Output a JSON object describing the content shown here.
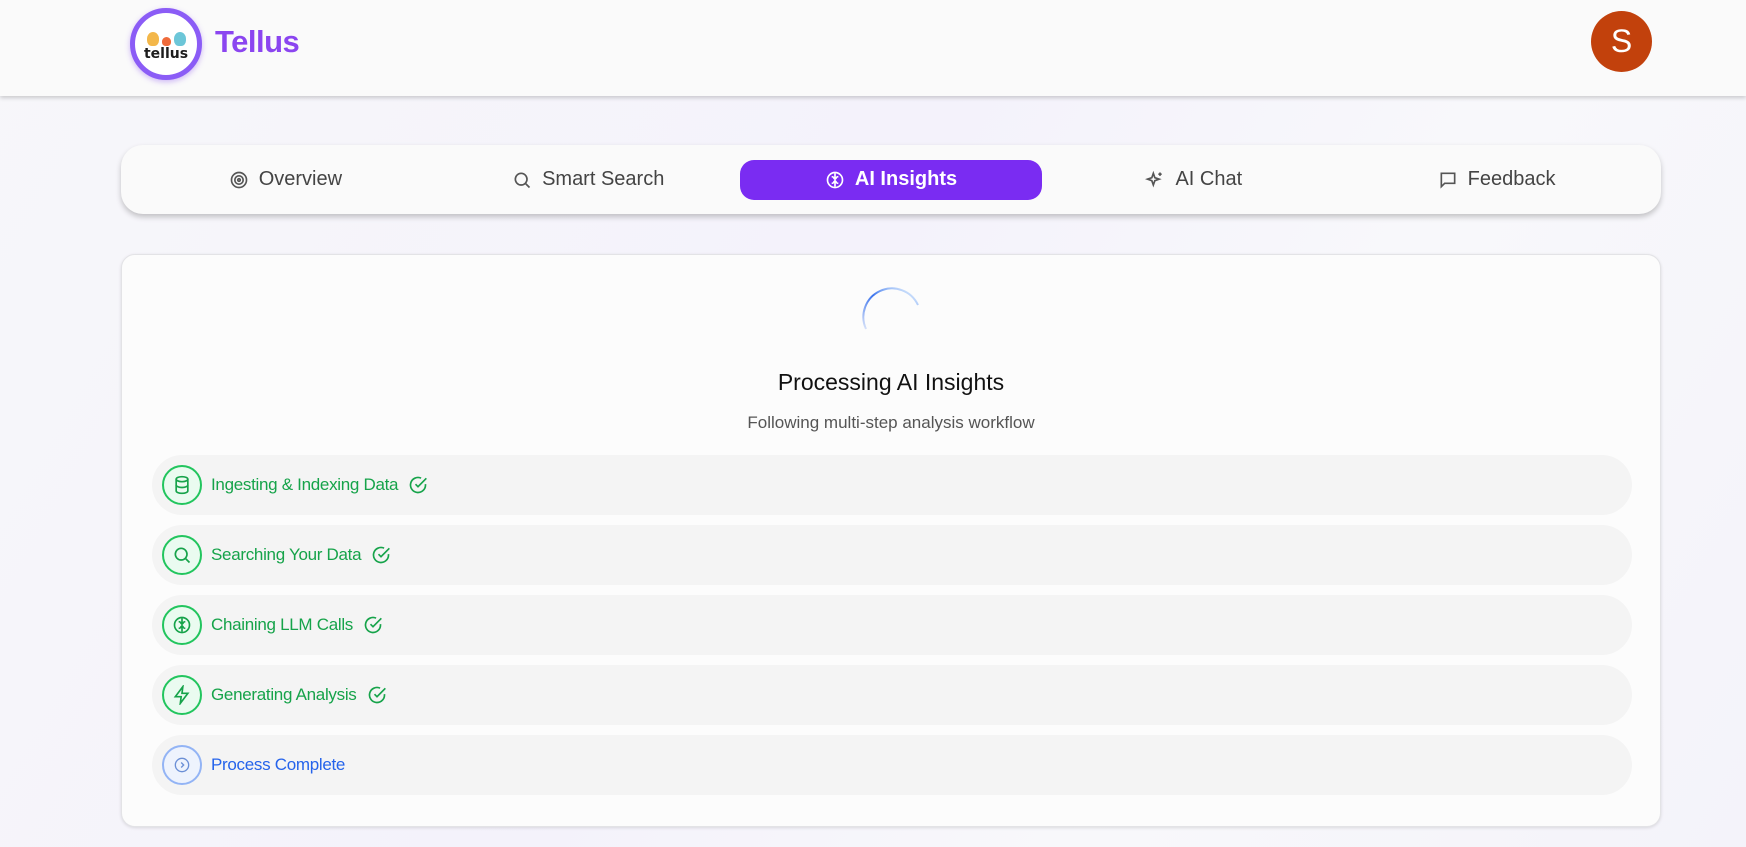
{
  "header": {
    "logo_text": "tellus",
    "brand": "Tellus",
    "avatar_initial": "S"
  },
  "tabs": [
    {
      "label": "Overview",
      "icon": "target-icon",
      "active": false
    },
    {
      "label": "Smart Search",
      "icon": "search-icon",
      "active": false
    },
    {
      "label": "AI Insights",
      "icon": "brain-icon",
      "active": true
    },
    {
      "label": "AI Chat",
      "icon": "sparkles-icon",
      "active": false
    },
    {
      "label": "Feedback",
      "icon": "message-icon",
      "active": false
    }
  ],
  "processing": {
    "title": "Processing AI Insights",
    "subtitle": "Following multi-step analysis workflow",
    "steps": [
      {
        "label": "Ingesting & Indexing Data",
        "icon": "database-icon",
        "status": "done"
      },
      {
        "label": "Searching Your Data",
        "icon": "search-icon",
        "status": "done"
      },
      {
        "label": "Chaining LLM Calls",
        "icon": "brain-icon",
        "status": "done"
      },
      {
        "label": "Generating Analysis",
        "icon": "zap-icon",
        "status": "done"
      },
      {
        "label": "Process Complete",
        "icon": "chevron-circle-icon",
        "status": "pending"
      }
    ]
  },
  "colors": {
    "brand": "#8b45f0",
    "active_tab": "#7a2cf2",
    "avatar": "#c2410c",
    "done": "#16a34a",
    "pending": "#2563eb"
  }
}
